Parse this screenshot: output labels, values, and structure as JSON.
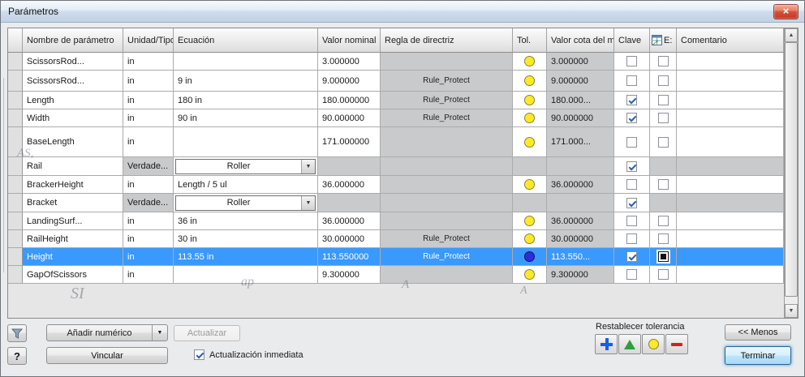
{
  "window": {
    "title": "Parámetros"
  },
  "icons": {
    "close": "×",
    "dropdown": "▼",
    "scroll_up": "▲",
    "scroll_down": "▼",
    "help": "?"
  },
  "table": {
    "headers": {
      "name": "Nombre de parámetro",
      "unit": "Unidad/Tipo",
      "equation": "Ecuación",
      "nominal": "Valor nominal",
      "rule": "Regla de directriz",
      "tol": "Tol.",
      "model_value": "Valor cota del modelo",
      "key": "Clave",
      "export": "E:",
      "comment": "Comentario"
    },
    "rows": [
      {
        "name": "ScissorsRod...",
        "unit": "in",
        "equation": "",
        "nominal": "3.000000",
        "rule": "",
        "tol": "yellow",
        "model_value": "3.000000",
        "key": false,
        "export": false,
        "comment": ""
      },
      {
        "name": "ScissorsRod...",
        "unit": "in",
        "equation": "9 in",
        "nominal": "9.000000",
        "rule": "Rule_Protect",
        "tol": "yellow",
        "model_value": "9.000000",
        "key": false,
        "export": false,
        "comment": ""
      },
      {
        "name": "Length",
        "unit": "in",
        "equation": "180 in",
        "nominal": "180.000000",
        "rule": "Rule_Protect",
        "tol": "yellow",
        "model_value": "180.000...",
        "key": true,
        "export": false,
        "comment": ""
      },
      {
        "name": "Width",
        "unit": "in",
        "equation": "90 in",
        "nominal": "90.000000",
        "rule": "Rule_Protect",
        "tol": "yellow",
        "model_value": "90.000000",
        "key": true,
        "export": false,
        "comment": ""
      },
      {
        "name": "BaseLength",
        "unit": "in",
        "equation": "",
        "nominal": "171.000000",
        "rule": "",
        "tol": "yellow",
        "model_value": "171.000...",
        "key": false,
        "export": false,
        "comment": ""
      },
      {
        "name": "Rail",
        "unit": "Verdade...",
        "equation": "Roller",
        "control": "dropdown",
        "nominal": "",
        "rule": "",
        "tol": "",
        "model_value": "",
        "key": true,
        "export": null,
        "comment": ""
      },
      {
        "name": "BrackerHeight",
        "unit": "in",
        "equation": "Length / 5 ul",
        "nominal": "36.000000",
        "rule": "",
        "tol": "yellow",
        "model_value": "36.000000",
        "key": false,
        "export": false,
        "comment": ""
      },
      {
        "name": "Bracket",
        "unit": "Verdade...",
        "equation": "Roller",
        "control": "dropdown",
        "nominal": "",
        "rule": "",
        "tol": "",
        "model_value": "",
        "key": true,
        "export": null,
        "comment": ""
      },
      {
        "name": "LandingSurf...",
        "unit": "in",
        "equation": "36 in",
        "nominal": "36.000000",
        "rule": "",
        "tol": "yellow",
        "model_value": "36.000000",
        "key": false,
        "export": false,
        "comment": ""
      },
      {
        "name": "RailHeight",
        "unit": "in",
        "equation": "30 in",
        "nominal": "30.000000",
        "rule": "Rule_Protect",
        "tol": "yellow",
        "model_value": "30.000000",
        "key": false,
        "export": false,
        "comment": ""
      },
      {
        "name": "Height",
        "unit": "in",
        "equation": "113.55 in",
        "nominal": "113.550000",
        "rule": "Rule_Protect",
        "tol": "blue",
        "model_value": "113.550...",
        "key": true,
        "export": "dark",
        "comment": "",
        "selected": true
      },
      {
        "name": "GapOfScissors",
        "unit": "in",
        "equation": "",
        "nominal": "9.300000",
        "rule": "",
        "tol": "yellow",
        "model_value": "9.300000",
        "key": false,
        "export": false,
        "comment": ""
      }
    ],
    "selection_color": "#3a99fd",
    "tolerance_colors": {
      "yellow": "#ffe926",
      "blue": "#2d2ddb"
    }
  },
  "footer": {
    "add_numeric_label": "Añadir numérico",
    "update_label": "Actualizar",
    "link_label": "Vincular",
    "immediate_update_label": "Actualización inmediata",
    "immediate_update_checked": true,
    "reset_tolerance_label": "Restablecer tolerancia",
    "less_label": "<< Menos",
    "finish_label": "Terminar"
  },
  "watermarks": [
    "AS,",
    "SI",
    "ap",
    "A",
    "A"
  ]
}
